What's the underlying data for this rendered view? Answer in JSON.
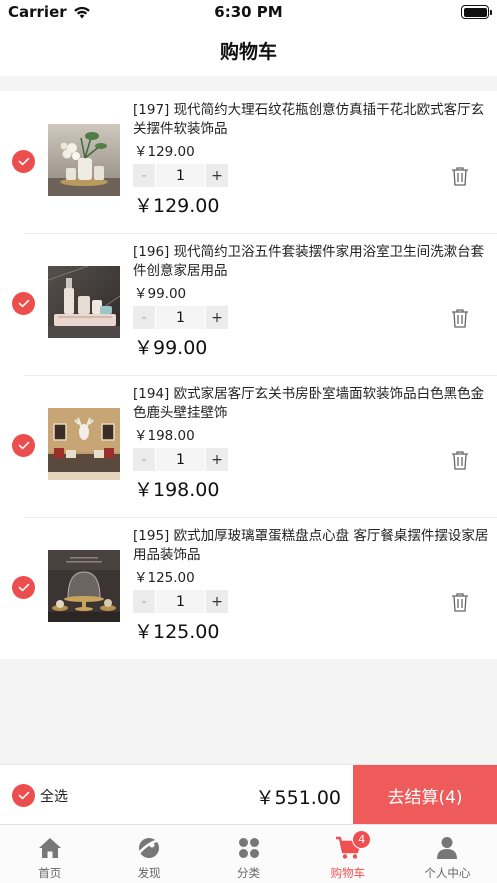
{
  "status_bar": {
    "carrier": "Carrier",
    "time": "6:30 PM"
  },
  "header": {
    "title": "购物车"
  },
  "colors": {
    "accent": "#ef5a5a",
    "check": "#ec4d4d",
    "background": "#f4f4f4"
  },
  "cart": {
    "items": [
      {
        "title": "[197] 现代简约大理石纹花瓶创意仿真插干花北欧式客厅玄关摆件软装饰品",
        "unit_price": "￥129.00",
        "quantity": "1",
        "minus_label": "-",
        "plus_label": "+",
        "line_total": "￥129.00",
        "selected": true,
        "image_icon": "vase-flowers-image"
      },
      {
        "title": "[196] 现代简约卫浴五件套装摆件家用浴室卫生间洗漱台套件创意家居用品",
        "unit_price": "￥99.00",
        "quantity": "1",
        "minus_label": "-",
        "plus_label": "+",
        "line_total": "￥99.00",
        "selected": true,
        "image_icon": "bathroom-set-image"
      },
      {
        "title": "[194] 欧式家居客厅玄关书房卧室墙面软装饰品白色黑色金色鹿头壁挂壁饰",
        "unit_price": "￥198.00",
        "quantity": "1",
        "minus_label": "-",
        "plus_label": "+",
        "line_total": "￥198.00",
        "selected": true,
        "image_icon": "deer-head-image"
      },
      {
        "title": "[195] 欧式加厚玻璃罩蛋糕盘点心盘 客厅餐桌摆件摆设家居用品装饰品",
        "unit_price": "￥125.00",
        "quantity": "1",
        "minus_label": "-",
        "plus_label": "+",
        "line_total": "￥125.00",
        "selected": true,
        "image_icon": "cake-dome-image"
      }
    ]
  },
  "bottom_bar": {
    "select_all_label": "全选",
    "total": "￥551.00",
    "checkout_label": "去结算(4)"
  },
  "tab_bar": {
    "tabs": [
      {
        "label": "首页",
        "icon": "home-icon"
      },
      {
        "label": "发现",
        "icon": "discover-icon"
      },
      {
        "label": "分类",
        "icon": "category-icon"
      },
      {
        "label": "购物车",
        "icon": "cart-icon",
        "badge": "4",
        "active": true
      },
      {
        "label": "个人中心",
        "icon": "person-icon"
      }
    ]
  }
}
